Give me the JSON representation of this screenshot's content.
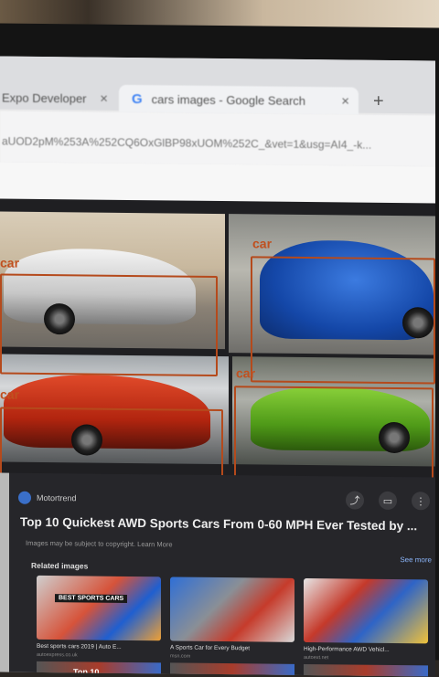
{
  "browser": {
    "tabs": [
      {
        "label": "Expo Developer",
        "active": false
      },
      {
        "label": "cars images - Google Search",
        "active": true
      }
    ],
    "close_icon": "×",
    "new_tab_icon": "+",
    "address": "aUOD2pM%253A%252CQ6OxGlBP98xUOM%252C_&vet=1&usg=AI4_-k..."
  },
  "detections": [
    {
      "label": "car"
    },
    {
      "label": "car"
    },
    {
      "label": "car"
    },
    {
      "label": "car"
    }
  ],
  "panel": {
    "source": "Motortrend",
    "title": "Top 10 Quickest AWD Sports Cars From 0-60 MPH Ever Tested by ...",
    "copyright": "Images may be subject to copyright. Learn More",
    "related_heading": "Related images",
    "see_more": "See more",
    "related": [
      {
        "caption": "Best sports cars 2019 | Auto E...",
        "source": "autoexpress.co.uk",
        "banner": "BEST SPORTS CARS"
      },
      {
        "caption": "A Sports Car for Every Budget",
        "source": "msn.com"
      },
      {
        "caption": "High-Performance AWD Vehicl...",
        "source": "autoext.net"
      }
    ],
    "bottom_label": "Top 10"
  },
  "colors": {
    "bbox": "#b54a1c",
    "label": "#c0501f"
  }
}
